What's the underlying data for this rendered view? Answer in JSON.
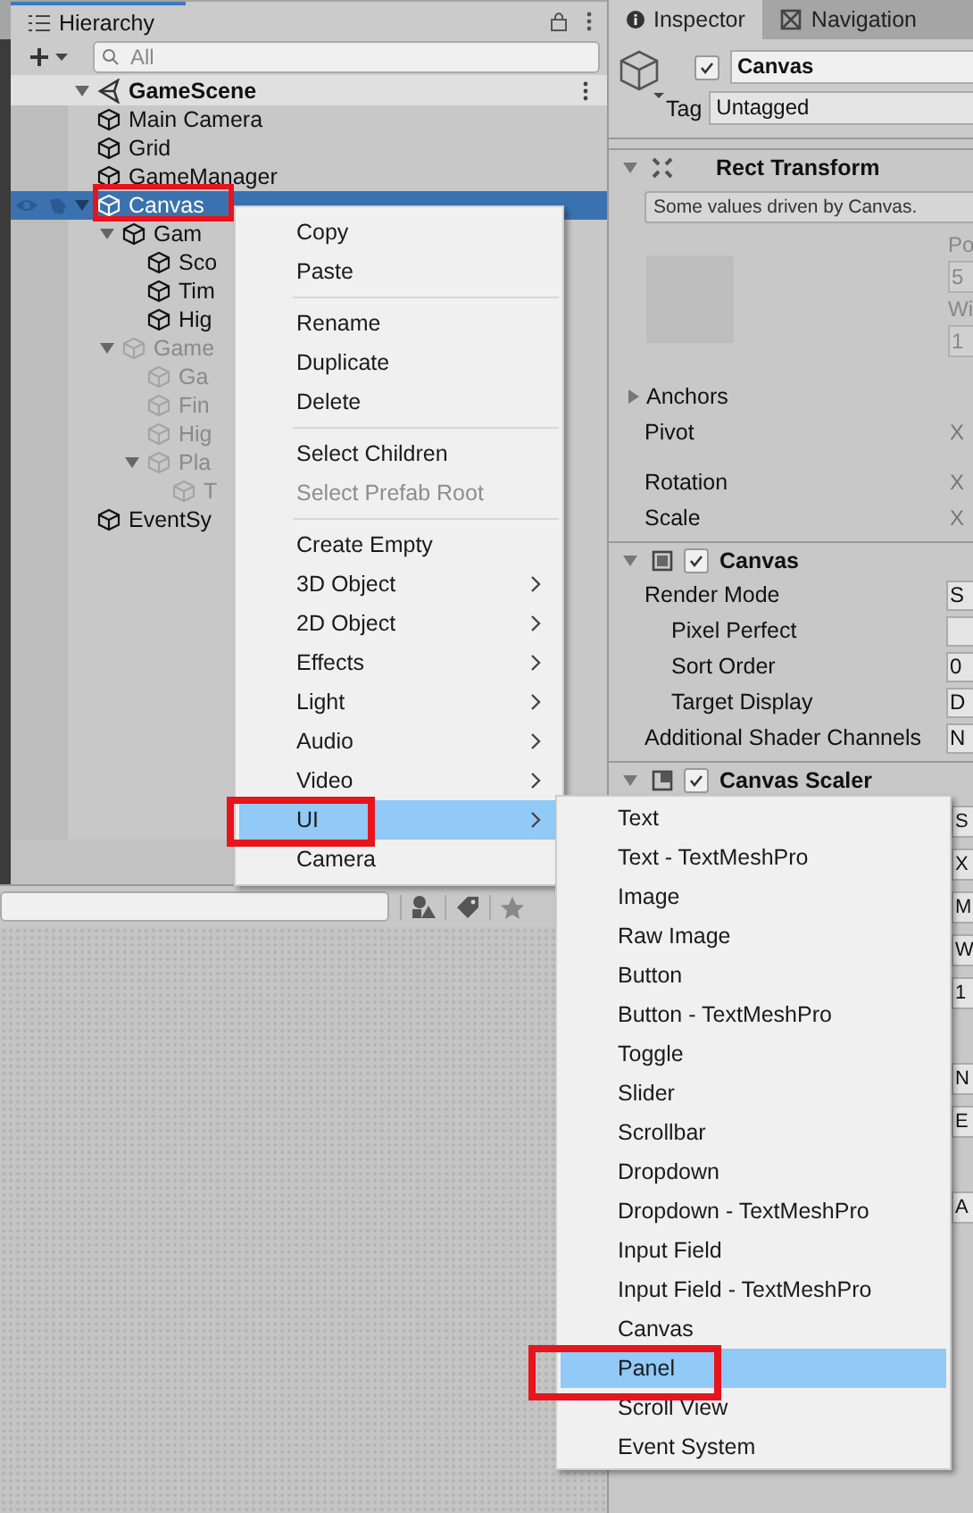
{
  "hierarchy": {
    "tab": "Hierarchy",
    "search_placeholder": "All",
    "scene": "GameScene",
    "items": [
      {
        "label": "Main Camera",
        "selected": false,
        "disabled": false
      },
      {
        "label": "Grid",
        "selected": false,
        "disabled": false
      },
      {
        "label": "GameManager",
        "selected": false,
        "disabled": false
      },
      {
        "label": "Canvas",
        "selected": true,
        "disabled": false,
        "expanded": true,
        "children": [
          {
            "label": "Gam",
            "selected": false,
            "disabled": false,
            "expanded": true,
            "children": [
              {
                "label": "Sco",
                "selected": false,
                "disabled": false
              },
              {
                "label": "Tim",
                "selected": false,
                "disabled": false
              },
              {
                "label": "Hig",
                "selected": false,
                "disabled": false
              }
            ]
          },
          {
            "label": "Game",
            "selected": false,
            "disabled": true,
            "expanded": true,
            "children": [
              {
                "label": "Ga",
                "selected": false,
                "disabled": true
              },
              {
                "label": "Fin",
                "selected": false,
                "disabled": true
              },
              {
                "label": "Hig",
                "selected": false,
                "disabled": true
              },
              {
                "label": "Pla",
                "selected": false,
                "disabled": true,
                "expanded": true,
                "children": [
                  {
                    "label": "T",
                    "selected": false,
                    "disabled": true
                  }
                ]
              }
            ]
          }
        ]
      },
      {
        "label": "EventSy",
        "selected": false,
        "disabled": false
      }
    ]
  },
  "inspector": {
    "tabs": [
      {
        "label": "Inspector",
        "selected": true
      },
      {
        "label": "Navigation",
        "selected": false
      }
    ],
    "object_name": "Canvas",
    "active": true,
    "tag_label": "Tag",
    "tag": "Untagged",
    "rect_transform": {
      "title": "Rect Transform",
      "note": "Some values driven by Canvas.",
      "pos_label": "Po",
      "pos_value": "5",
      "width_label": "Wi",
      "width_value": "1",
      "rows": [
        {
          "label": "Anchors",
          "axis": "",
          "expandable": true
        },
        {
          "label": "Pivot",
          "axis": "X",
          "expandable": false
        },
        {
          "label": "Rotation",
          "axis": "X",
          "expandable": false
        },
        {
          "label": "Scale",
          "axis": "X",
          "expandable": false
        }
      ]
    },
    "canvas": {
      "title": "Canvas",
      "enabled": true,
      "rows": [
        {
          "label": "Render Mode",
          "value": "S",
          "indent": false
        },
        {
          "label": "Pixel Perfect",
          "value": "",
          "indent": true
        },
        {
          "label": "Sort Order",
          "value": "0",
          "indent": true
        },
        {
          "label": "Target Display",
          "value": "D",
          "indent": true
        },
        {
          "label": "Additional Shader Channels",
          "value": "N",
          "indent": false
        }
      ]
    },
    "canvas_scaler": {
      "title": "Canvas Scaler",
      "enabled": true,
      "values": [
        "S",
        "X",
        "M",
        "W",
        "1",
        "N",
        "E",
        "A"
      ]
    }
  },
  "context_menu": [
    {
      "kind": "item",
      "label": "Copy",
      "disabled": false,
      "selected": false,
      "submenu": false
    },
    {
      "kind": "item",
      "label": "Paste",
      "disabled": false,
      "selected": false,
      "submenu": false
    },
    {
      "kind": "separator"
    },
    {
      "kind": "item",
      "label": "Rename",
      "disabled": false,
      "selected": false,
      "submenu": false
    },
    {
      "kind": "item",
      "label": "Duplicate",
      "disabled": false,
      "selected": false,
      "submenu": false
    },
    {
      "kind": "item",
      "label": "Delete",
      "disabled": false,
      "selected": false,
      "submenu": false
    },
    {
      "kind": "separator"
    },
    {
      "kind": "item",
      "label": "Select Children",
      "disabled": false,
      "selected": false,
      "submenu": false
    },
    {
      "kind": "item",
      "label": "Select Prefab Root",
      "disabled": true,
      "selected": false,
      "submenu": false
    },
    {
      "kind": "separator"
    },
    {
      "kind": "item",
      "label": "Create Empty",
      "disabled": false,
      "selected": false,
      "submenu": false
    },
    {
      "kind": "item",
      "label": "3D Object",
      "disabled": false,
      "selected": false,
      "submenu": true
    },
    {
      "kind": "item",
      "label": "2D Object",
      "disabled": false,
      "selected": false,
      "submenu": true
    },
    {
      "kind": "item",
      "label": "Effects",
      "disabled": false,
      "selected": false,
      "submenu": true
    },
    {
      "kind": "item",
      "label": "Light",
      "disabled": false,
      "selected": false,
      "submenu": true
    },
    {
      "kind": "item",
      "label": "Audio",
      "disabled": false,
      "selected": false,
      "submenu": true
    },
    {
      "kind": "item",
      "label": "Video",
      "disabled": false,
      "selected": false,
      "submenu": true
    },
    {
      "kind": "item",
      "label": "UI",
      "disabled": false,
      "selected": true,
      "submenu": true
    },
    {
      "kind": "item",
      "label": "Camera",
      "disabled": false,
      "selected": false,
      "submenu": false
    }
  ],
  "ui_submenu": [
    {
      "label": "Text",
      "selected": false
    },
    {
      "label": "Text - TextMeshPro",
      "selected": false
    },
    {
      "label": "Image",
      "selected": false
    },
    {
      "label": "Raw Image",
      "selected": false
    },
    {
      "label": "Button",
      "selected": false
    },
    {
      "label": "Button - TextMeshPro",
      "selected": false
    },
    {
      "label": "Toggle",
      "selected": false
    },
    {
      "label": "Slider",
      "selected": false
    },
    {
      "label": "Scrollbar",
      "selected": false
    },
    {
      "label": "Dropdown",
      "selected": false
    },
    {
      "label": "Dropdown - TextMeshPro",
      "selected": false
    },
    {
      "label": "Input Field",
      "selected": false
    },
    {
      "label": "Input Field - TextMeshPro",
      "selected": false
    },
    {
      "label": "Canvas",
      "selected": false
    },
    {
      "label": "Panel",
      "selected": true
    },
    {
      "label": "Scroll View",
      "selected": false
    },
    {
      "label": "Event System",
      "selected": false
    }
  ]
}
